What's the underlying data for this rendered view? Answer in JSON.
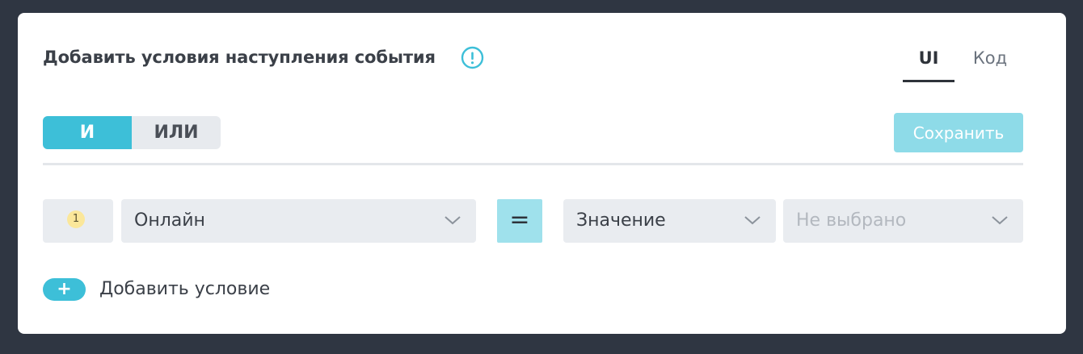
{
  "header": {
    "title": "Добавить условия наступления события",
    "info_icon": "exclamation-circle-icon",
    "view_tabs": [
      {
        "label": "UI",
        "active": true
      },
      {
        "label": "Код",
        "active": false
      }
    ]
  },
  "logic": {
    "and_label": "И",
    "or_label": "ИЛИ",
    "selected": "И"
  },
  "toolbar": {
    "save_label": "Сохранить"
  },
  "condition": {
    "index": "1",
    "field": "Онлайн",
    "operator": "=",
    "value_type": "Значение",
    "value_placeholder": "Не выбрано"
  },
  "add_condition": {
    "icon": "+",
    "label": "Добавить условие"
  },
  "colors": {
    "accent": "#3dbfd8",
    "save_disabled": "#8edbe8",
    "operator_bg": "#9fe1ec",
    "badge": "#fbe79a"
  }
}
